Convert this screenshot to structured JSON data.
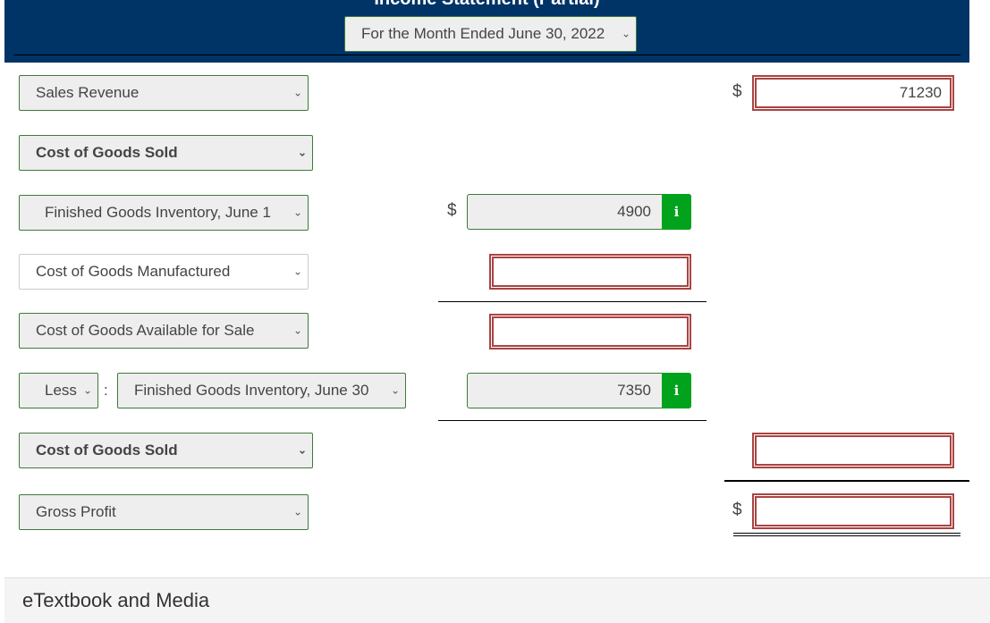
{
  "header": {
    "title": "Income Statement (Partial)",
    "period_select": "For the Month Ended June 30, 2022"
  },
  "rows": {
    "sales_revenue": {
      "label": "Sales Revenue",
      "currency": "$",
      "value": "71230"
    },
    "cogs_heading": {
      "label": "Cost of Goods Sold"
    },
    "fg_inventory_begin": {
      "label": "Finished Goods Inventory, June 1",
      "currency": "$",
      "value": "4900",
      "info_icon": "i"
    },
    "cogm": {
      "label": "Cost of Goods Manufactured",
      "value": ""
    },
    "cogas": {
      "label": "Cost of Goods Available for Sale",
      "value": ""
    },
    "less": {
      "operator": "Less",
      "separator": ":",
      "label": "Finished Goods Inventory, June 30",
      "value": "7350",
      "info_icon": "i"
    },
    "cogs_total": {
      "label": "Cost of Goods Sold",
      "value": ""
    },
    "gross_profit": {
      "label": "Gross Profit",
      "currency": "$",
      "value": ""
    }
  },
  "footer": {
    "label": "eTextbook and Media"
  },
  "colors": {
    "header_bg": "#003366",
    "invalid_border": "#a94442",
    "valid_border": "#3f7a3a",
    "info_green": "#00a31b"
  }
}
